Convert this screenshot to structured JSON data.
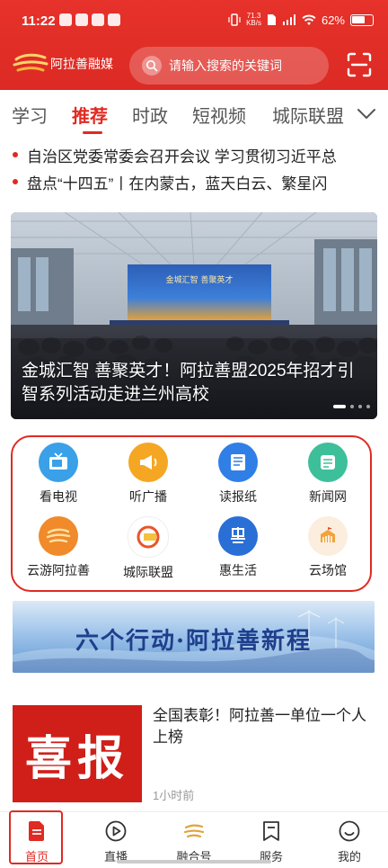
{
  "status": {
    "time": "11:22",
    "netspeed_value": "71.3",
    "netspeed_unit": "KB/s",
    "battery": "62%"
  },
  "header": {
    "app_name": "阿拉善融媒",
    "search_placeholder": "请输入搜索的关键词"
  },
  "tabs": [
    {
      "label": "学习"
    },
    {
      "label": "推荐",
      "active": true
    },
    {
      "label": "时政"
    },
    {
      "label": "短视频"
    },
    {
      "label": "城际联盟"
    }
  ],
  "ticker": [
    "自治区党委常委会召开会议  学习贯彻习近平总",
    "盘点“十四五”丨在内蒙古，蓝天白云、繁星闪"
  ],
  "banner": {
    "title": "金城汇智  善聚英才！阿拉善盟2025年招才引智系列活动走进兰州高校",
    "screen_text": "金城汇智  善聚英才"
  },
  "services": [
    {
      "label": "看电视",
      "icon": "tv-icon",
      "color": "#3aa0e8"
    },
    {
      "label": "听广播",
      "icon": "megaphone-icon",
      "color": "#f5a623"
    },
    {
      "label": "读报纸",
      "icon": "newspaper-icon",
      "color": "#2f7fe6"
    },
    {
      "label": "新闻网",
      "icon": "news-web-icon",
      "color": "#3dbf9a"
    },
    {
      "label": "云游阿拉善",
      "icon": "tour-logo-icon",
      "color": "#f08a2a"
    },
    {
      "label": "城际联盟",
      "icon": "alliance-icon",
      "color": "#ffffff"
    },
    {
      "label": "惠生活",
      "icon": "hui-icon",
      "color": "#2a6fd6"
    },
    {
      "label": "云场馆",
      "icon": "venue-icon",
      "color": "#fbeede"
    }
  ],
  "slogan": "六个行动·阿拉善新程",
  "news": [
    {
      "title": "全国表彰！阿拉善一单位一个人上榜",
      "time": "1小时前",
      "image_text": "喜报"
    }
  ],
  "bottom_nav": [
    {
      "label": "首页",
      "active": true
    },
    {
      "label": "直播"
    },
    {
      "label": "融合号"
    },
    {
      "label": "服务"
    },
    {
      "label": "我的"
    }
  ]
}
